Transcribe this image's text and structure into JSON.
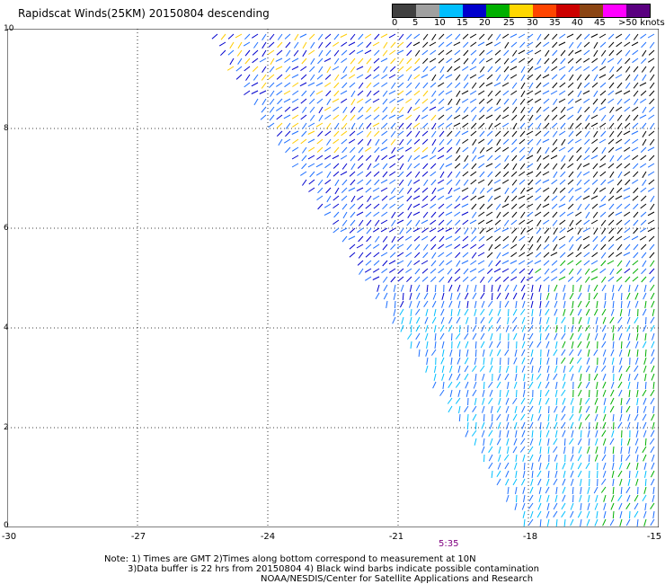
{
  "title": "Rapidscat Winds(25KM) 20150804 descending",
  "legend": {
    "labels": [
      "0",
      "5",
      "10",
      "15",
      "20",
      "25",
      "30",
      "35",
      "40",
      "45",
      ">50 knots"
    ],
    "colors": [
      "#000000",
      "#808080",
      "#0000ff",
      "#00a0ff",
      "#00c000",
      "#ffff00",
      "#ff8000",
      "#ff0000",
      "#a0522d",
      "#ff00ff",
      "#800080"
    ]
  },
  "axes": {
    "x_ticks": [
      "-30",
      "-27",
      "-24",
      "-21",
      "-18",
      "-15"
    ],
    "y_ticks": [
      "10",
      "8",
      "6",
      "4",
      "2",
      "0"
    ]
  },
  "time_label": "5:35",
  "notes": [
    "Note: 1) Times are GMT 2)Times along bottom correspond to measurement at 10N",
    "3)Data buffer is 22 hrs from 20150804 4) Black wind barbs indicate possible contamination",
    "NOAA/NESDIS/Center for Satellite Applications and Research"
  ]
}
